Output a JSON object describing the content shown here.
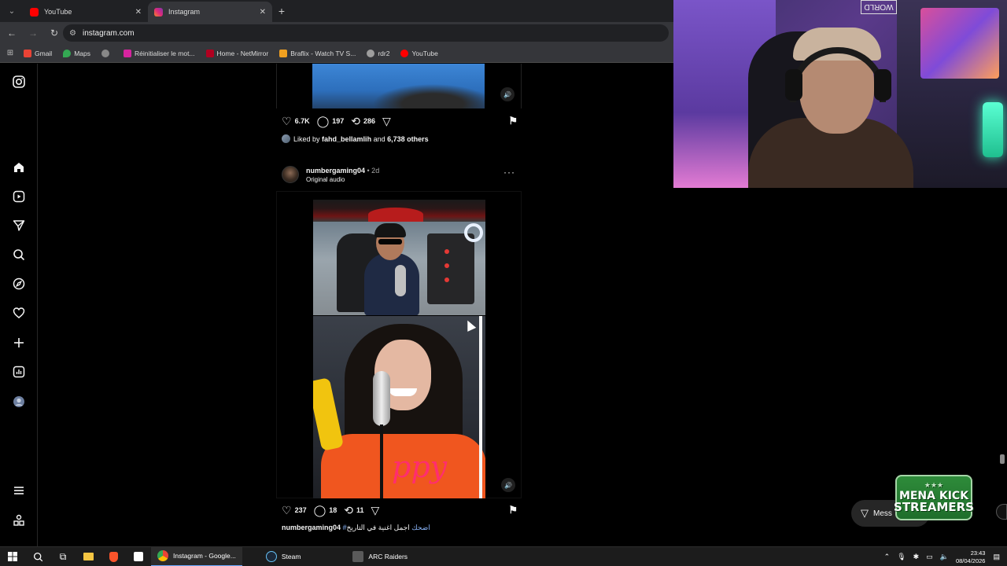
{
  "browser": {
    "tabs": [
      {
        "label": "YouTube",
        "color": "#ff0000",
        "active": false
      },
      {
        "label": "Instagram",
        "color": "#d6249f",
        "active": true
      }
    ],
    "url": "instagram.com",
    "bookmarks": [
      {
        "label": "Gmail",
        "color": "#ea4335"
      },
      {
        "label": "Maps",
        "color": "#34a853"
      },
      {
        "label": "",
        "color": "#888888"
      },
      {
        "label": "Réinitialiser le mot...",
        "color": "#d6249f"
      },
      {
        "label": "Home - NetMirror",
        "color": "#b00020"
      },
      {
        "label": "Braflix - Watch TV S...",
        "color": "#f0a020"
      },
      {
        "label": "rdr2",
        "color": "#9e9e9e"
      },
      {
        "label": "YouTube",
        "color": "#ff0000"
      }
    ]
  },
  "instagram": {
    "nav_icons": [
      "instagram-logo-icon",
      "home-icon",
      "reels-icon",
      "messages-icon",
      "search-icon",
      "explore-icon",
      "notifications-icon",
      "create-icon",
      "dashboard-icon",
      "profile-icon",
      "menu-icon",
      "threads-icon"
    ],
    "post1": {
      "likes": "6.7K",
      "comments": "197",
      "reposts": "286",
      "liked_by_prefix": "Liked by",
      "liked_by_user": "fahd_bellamlih",
      "liked_by_and": "and",
      "liked_by_others": "6,738 others"
    },
    "post2": {
      "username": "numbergaming04",
      "time": "• 2d",
      "audio": "Original audio",
      "more": "···",
      "likes": "237",
      "comments": "18",
      "reposts": "11",
      "caption_user": "numbergaming04",
      "caption_tag": "#اضحك",
      "caption_text": "اجمل اغنية في التاريخ",
      "shirt_text": "ppy"
    },
    "messages_label": "Mess"
  },
  "webcam": {
    "sign": "WORLD"
  },
  "badge": {
    "stars": "★★★",
    "line1": "MENA KICK",
    "line2": "STREAMERS"
  },
  "taskbar": {
    "apps": [
      {
        "label": "Instagram - Google...",
        "color": "#4285f4",
        "active": true
      },
      {
        "label": "Steam",
        "color": "#1b2838",
        "active": false
      },
      {
        "label": "ARC Raiders",
        "color": "#5a5a5a",
        "active": false
      }
    ],
    "time": "23:43",
    "date": "08/04/2026"
  }
}
